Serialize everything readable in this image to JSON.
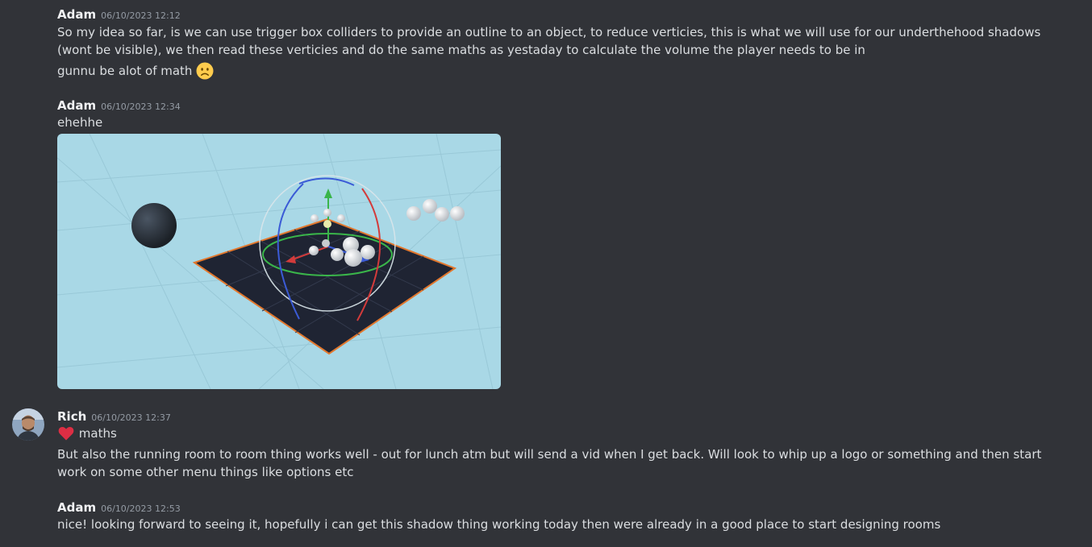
{
  "messages": [
    {
      "author": "Adam",
      "timestamp": "06/10/2023 12:12",
      "lines": [
        "So my idea so far, is we can use trigger box colliders to provide an outline to an object, to reduce verticies, this is what we will use for our underthehood shadows (wont be visible), we then read these verticies and do the same maths as yestaday to calculate the volume the player needs to be in",
        "gunnu be alot of math"
      ],
      "emoji": "slightly-frowning-face"
    },
    {
      "author": "Adam",
      "timestamp": "06/10/2023 12:34",
      "lines": [
        "ehehhe"
      ],
      "attachment": "3d-editor-scene-image"
    },
    {
      "author": "Rich",
      "timestamp": "06/10/2023 12:37",
      "avatar": "user-avatar",
      "lines": [
        "maths",
        "But also the running room to room thing works well - out for lunch atm but will send a vid when I get back. Will look to whip up a logo or something and then start work on some other menu things like options etc"
      ],
      "emoji": "red-heart"
    },
    {
      "author": "Adam",
      "timestamp": "06/10/2023 12:53",
      "lines": [
        "nice! looking forward to seeing it, hopefully i can get this shadow thing working today then were already in a good place to start designing rooms"
      ]
    }
  ],
  "colors": {
    "background": "#313338",
    "text": "#dbdee1",
    "author": "#f2f3f5",
    "timestamp": "#949ba4"
  }
}
